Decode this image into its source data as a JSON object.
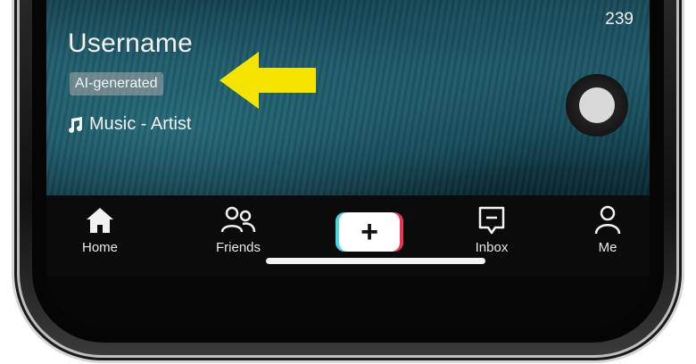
{
  "video": {
    "username": "Username",
    "ai_label": "AI-generated",
    "music": "Music - Artist",
    "share_count": "239"
  },
  "nav": {
    "items": [
      {
        "label": "Home",
        "icon": "home-icon"
      },
      {
        "label": "Friends",
        "icon": "friends-icon"
      },
      {
        "label": "",
        "icon": "create-plus-icon"
      },
      {
        "label": "Inbox",
        "icon": "inbox-icon"
      },
      {
        "label": "Me",
        "icon": "profile-icon"
      }
    ],
    "create_symbol": "+"
  },
  "annotation": {
    "arrow_color": "#f5e400",
    "arrow_icon": "arrow-left-icon"
  },
  "colors": {
    "tiktok_cyan": "#4fd6de",
    "tiktok_red": "#e8365a",
    "navbar_bg": "#0b0b0b"
  }
}
